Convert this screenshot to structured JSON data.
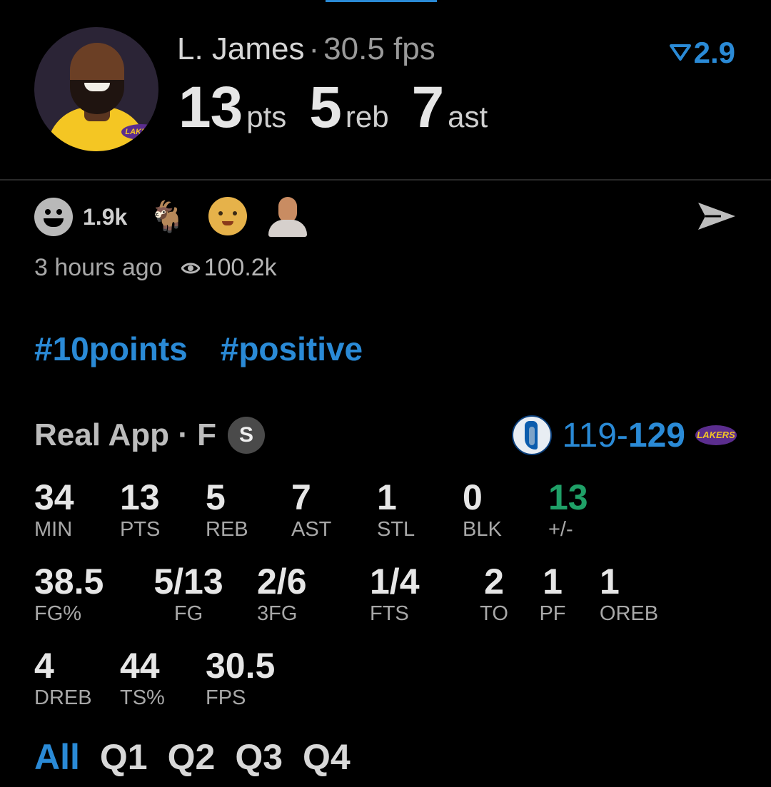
{
  "header": {
    "player_name": "L. James",
    "separator": "·",
    "fps_text": "30.5 fps",
    "rating_icon": "funnel-triangle-icon",
    "rating_value": "2.9",
    "avatar_badge": "LAKERS",
    "big_stats": [
      {
        "value": "13",
        "unit": "pts"
      },
      {
        "value": "5",
        "unit": "reb"
      },
      {
        "value": "7",
        "unit": "ast"
      }
    ]
  },
  "reactions": {
    "count": "1.9k",
    "emojis": [
      "smiley-face-icon",
      "goat-icon",
      "baby-face-icon",
      "bald-person-icon"
    ],
    "share_icon": "send-arrow-icon"
  },
  "meta": {
    "time_ago": "3 hours ago",
    "views": "100.2k"
  },
  "tags": [
    "#10points",
    "#positive"
  ],
  "game": {
    "title": "Real App · F",
    "badge": "S",
    "score_away": "119",
    "score_dash": "-",
    "score_home": "129",
    "home_logo_text": "LAKERS",
    "accent": "#2a8ad6",
    "positive_color": "#1fa067"
  },
  "box": {
    "row1": [
      {
        "value": "34",
        "label": "MIN"
      },
      {
        "value": "13",
        "label": "PTS"
      },
      {
        "value": "5",
        "label": "REB"
      },
      {
        "value": "7",
        "label": "AST"
      },
      {
        "value": "1",
        "label": "STL"
      },
      {
        "value": "0",
        "label": "BLK"
      },
      {
        "value": "13",
        "label": "+/-"
      }
    ],
    "row2": [
      {
        "value": "38.5",
        "label": "FG%"
      },
      {
        "value": "5/13",
        "label": "FG"
      },
      {
        "value": "2/6",
        "label": "3FG"
      },
      {
        "value": "1/4",
        "label": "FTS"
      },
      {
        "value": "2",
        "label": "TO"
      },
      {
        "value": "1",
        "label": "PF"
      },
      {
        "value": "1",
        "label": "OREB"
      }
    ],
    "row3": [
      {
        "value": "4",
        "label": "DREB"
      },
      {
        "value": "44",
        "label": "TS%"
      },
      {
        "value": "30.5",
        "label": "FPS"
      }
    ]
  },
  "quarters": [
    "All",
    "Q1",
    "Q2",
    "Q3",
    "Q4"
  ]
}
